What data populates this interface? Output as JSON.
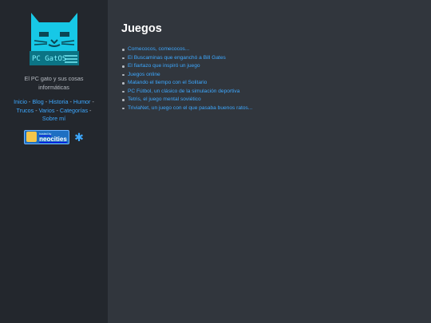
{
  "sidebar": {
    "logo_text": "PC GatOS",
    "tagline": "El PC gato y sus cosas informáticas",
    "nav": [
      {
        "label": "Inicio"
      },
      {
        "label": "Blog"
      },
      {
        "label": "Historia"
      },
      {
        "label": "Humor"
      },
      {
        "label": "Trucos"
      },
      {
        "label": "Varios"
      },
      {
        "label": "Categorías"
      },
      {
        "label": "Sobre mí"
      }
    ],
    "separator": " - ",
    "badge": {
      "small_text": "hosted by",
      "big_text": "neocities"
    },
    "colors": {
      "background": "#23272d",
      "link": "#3da8ff",
      "logo": "#17c8e6"
    }
  },
  "main": {
    "title": "Juegos",
    "items": [
      {
        "label": "Comecocos, comecocos..."
      },
      {
        "label": "El Buscaminas que enganchó a Bill Gates"
      },
      {
        "label": "El fiartazo que inspiró un juego"
      },
      {
        "label": "Juegos online"
      },
      {
        "label": "Matando el tiempo con el Solitario"
      },
      {
        "label": "PC Fútbol, un clásico de la simulación deportiva"
      },
      {
        "label": "Tetris, el juego mental soviético"
      },
      {
        "label": "TriviaNet, un juego con el que pasaba buenos ratos..."
      }
    ],
    "colors": {
      "background": "#31363d",
      "title": "#ffffff",
      "link": "#3da8ff"
    }
  },
  "icons": [
    "cat-logo-icon",
    "neocities-badge-icon",
    "star-icon"
  ]
}
